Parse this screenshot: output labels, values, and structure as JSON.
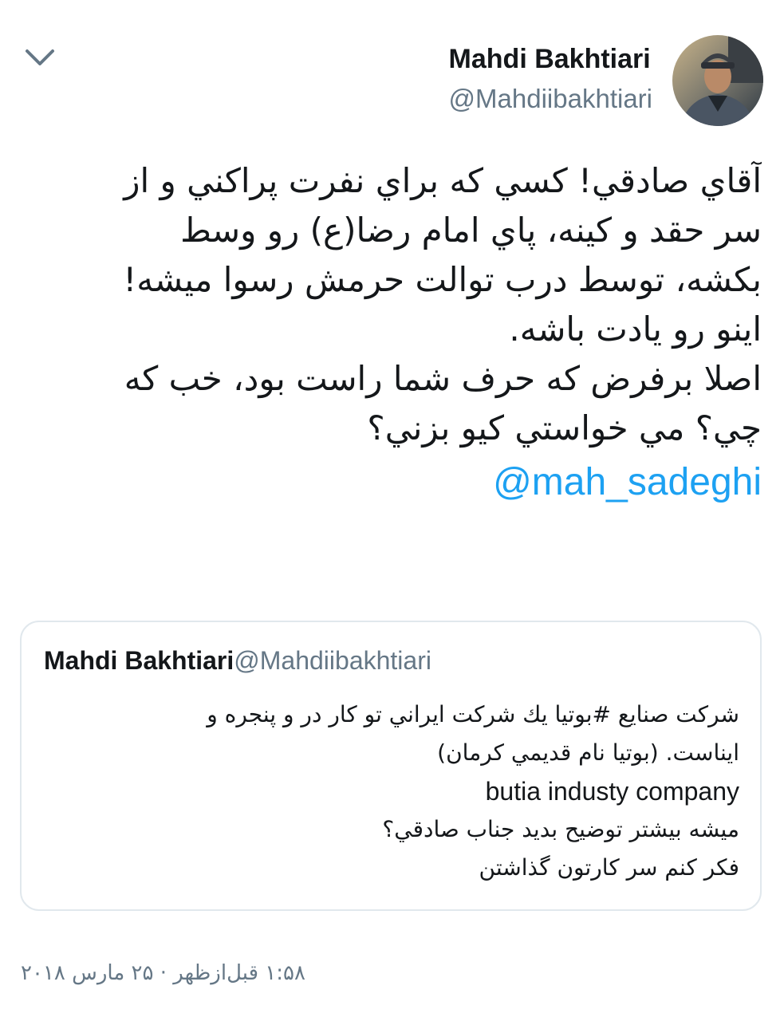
{
  "tweet": {
    "author_name": "Mahdi Bakhtiari",
    "author_handle": "@Mahdiibakhtiari",
    "avatar_icon": "profile-photo",
    "menu_icon": "chevron-down-icon",
    "text_lines": [
      "آقاي صادقي! كسي كه براي نفرت پراكني و از",
      "سر حقد و كينه، پاي امام رضا(ع) رو وسط",
      "بكشه، توسط درب توالت حرمش رسوا ميشه!",
      "اينو رو يادت باشه.",
      "اصلا برفرض كه حرف شما راست بود، خب كه",
      "چي؟ مي خواستي كيو بزني؟"
    ],
    "mention": "@mah_sadeghi",
    "timestamp": "۱:۵۸ قبل‌ازظهر · ۲۵ مارس ۲۰۱۸"
  },
  "quoted_tweet": {
    "author_name": "Mahdi Bakhtiari",
    "author_handle": "@Mahdiibakhtiari",
    "text_lines": [
      "شركت صنايع #بوتيا يك شركت ايراني تو كار در و پنجره و",
      "ايناست. (بوتيا نام قديمي كرمان)",
      "butia industy company",
      "ميشه بيشتر توضيح بديد جناب صادقي؟",
      "فكر كنم سر كارتون گذاشتن"
    ]
  },
  "colors": {
    "text": "#14171a",
    "secondary": "#657786",
    "link": "#1da1f2",
    "border": "#e1e8ed"
  }
}
